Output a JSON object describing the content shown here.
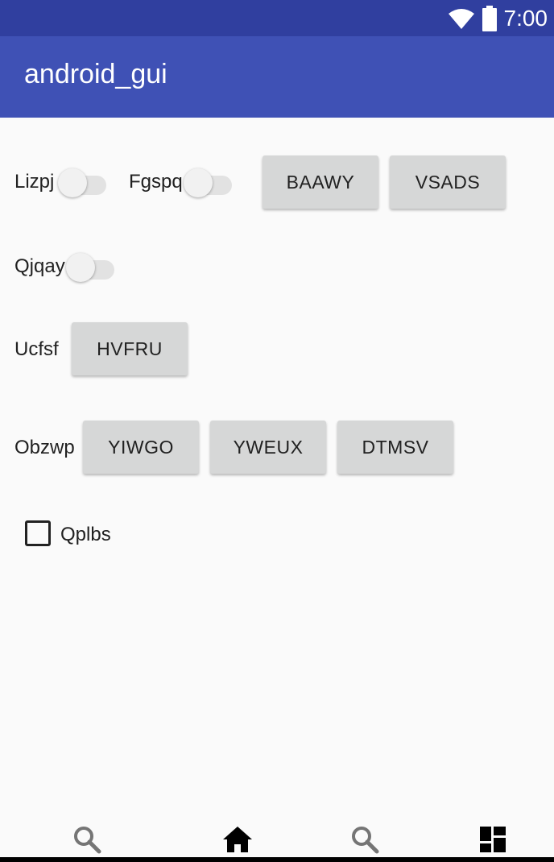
{
  "status_bar": {
    "time": "7:00",
    "wifi_icon": "wifi-icon",
    "battery_icon": "battery-icon"
  },
  "app_bar": {
    "title": "android_gui"
  },
  "rows": {
    "row1": {
      "switch1_label": "Lizpj",
      "switch2_label": "Fgspq",
      "button1": "BAAWY",
      "button2": "VSADS"
    },
    "row2": {
      "switch_label": "Qjqay"
    },
    "row3": {
      "label": "Ucfsf",
      "button": "HVFRU"
    },
    "row4": {
      "label": "Obzwp",
      "button1": "YIWGO",
      "button2": "YWEUX",
      "button3": "DTMSV"
    },
    "row5": {
      "checkbox_label": "Qplbs",
      "checked": false
    }
  },
  "bottom_nav": {
    "icons": [
      "search-icon",
      "home-icon",
      "search-icon",
      "dashboard-icon"
    ]
  },
  "colors": {
    "status_bar": "#303f9f",
    "app_bar": "#3f51b5",
    "background": "#fafafa",
    "button": "#d6d7d7"
  }
}
